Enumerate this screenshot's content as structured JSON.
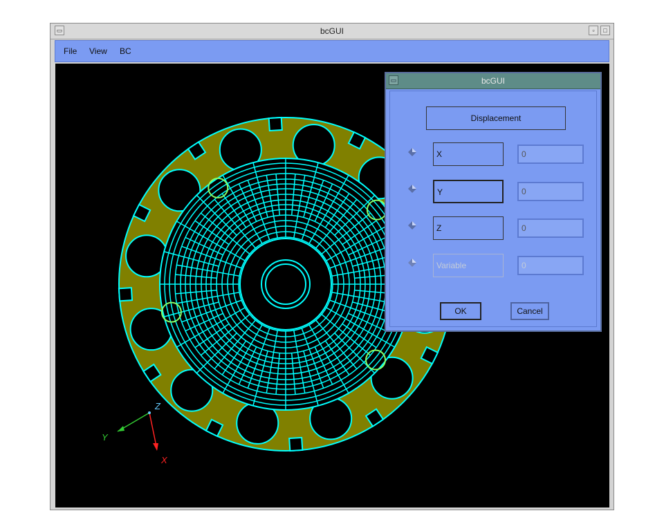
{
  "main_window": {
    "title": "bcGUI",
    "menu": [
      "File",
      "View",
      "BC"
    ]
  },
  "axes": {
    "x": "X",
    "y": "Y",
    "z": "Z"
  },
  "dialog": {
    "title": "bcGUI",
    "heading": "Displacement",
    "rows": [
      {
        "label": "X",
        "value": "0",
        "enabled": true
      },
      {
        "label": "Y",
        "value": "0",
        "enabled": true
      },
      {
        "label": "Z",
        "value": "0",
        "enabled": true
      },
      {
        "label": "Variable",
        "value": "0",
        "enabled": false
      }
    ],
    "ok_label": "OK",
    "cancel_label": "Cancel"
  },
  "colors": {
    "menubar": "#7b9bf2",
    "mesh": "#00ffff",
    "ring": "#808000",
    "highlight": "#88ff66",
    "viewport": "#000000"
  }
}
